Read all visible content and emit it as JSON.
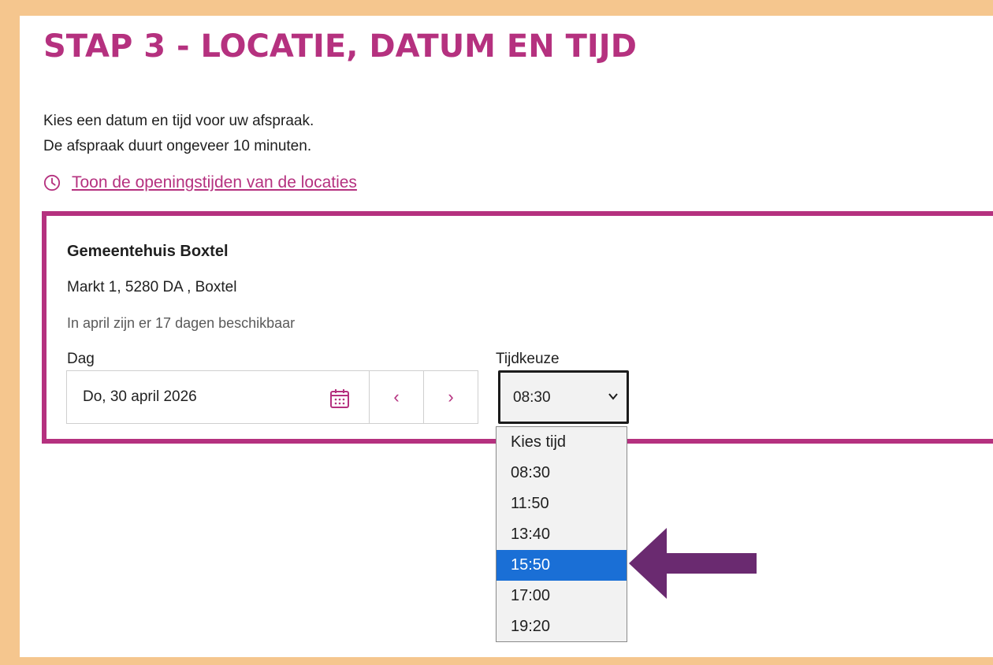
{
  "page_title": "STAP 3 - LOCATIE, DATUM EN TIJD",
  "intro": {
    "line1": "Kies een datum en tijd voor uw afspraak.",
    "line2": "De afspraak duurt ongeveer 10 minuten."
  },
  "hours_link": "Toon de openingstijden van de locaties",
  "location": {
    "name": "Gemeentehuis Boxtel",
    "address": "Markt 1, 5280 DA , Boxtel",
    "availability": "In april zijn er 17 dagen beschikbaar"
  },
  "day_field": {
    "label": "Dag",
    "value": "Do, 30 april 2026",
    "prev_label": "‹",
    "next_label": "›"
  },
  "time_field": {
    "label": "Tijdkeuze",
    "value": "08:30",
    "options": [
      "Kies tijd",
      "08:30",
      "11:50",
      "13:40",
      "15:50",
      "17:00",
      "19:20"
    ],
    "highlighted": "15:50"
  },
  "colors": {
    "accent": "#b5317f",
    "frame": "#f5c68e",
    "highlight": "#1a6fd6",
    "arrow": "#6a2a70"
  },
  "icons": [
    "clock-icon",
    "calendar-icon",
    "chevron-left-icon",
    "chevron-right-icon",
    "chevron-down-icon",
    "arrow-left-icon"
  ]
}
